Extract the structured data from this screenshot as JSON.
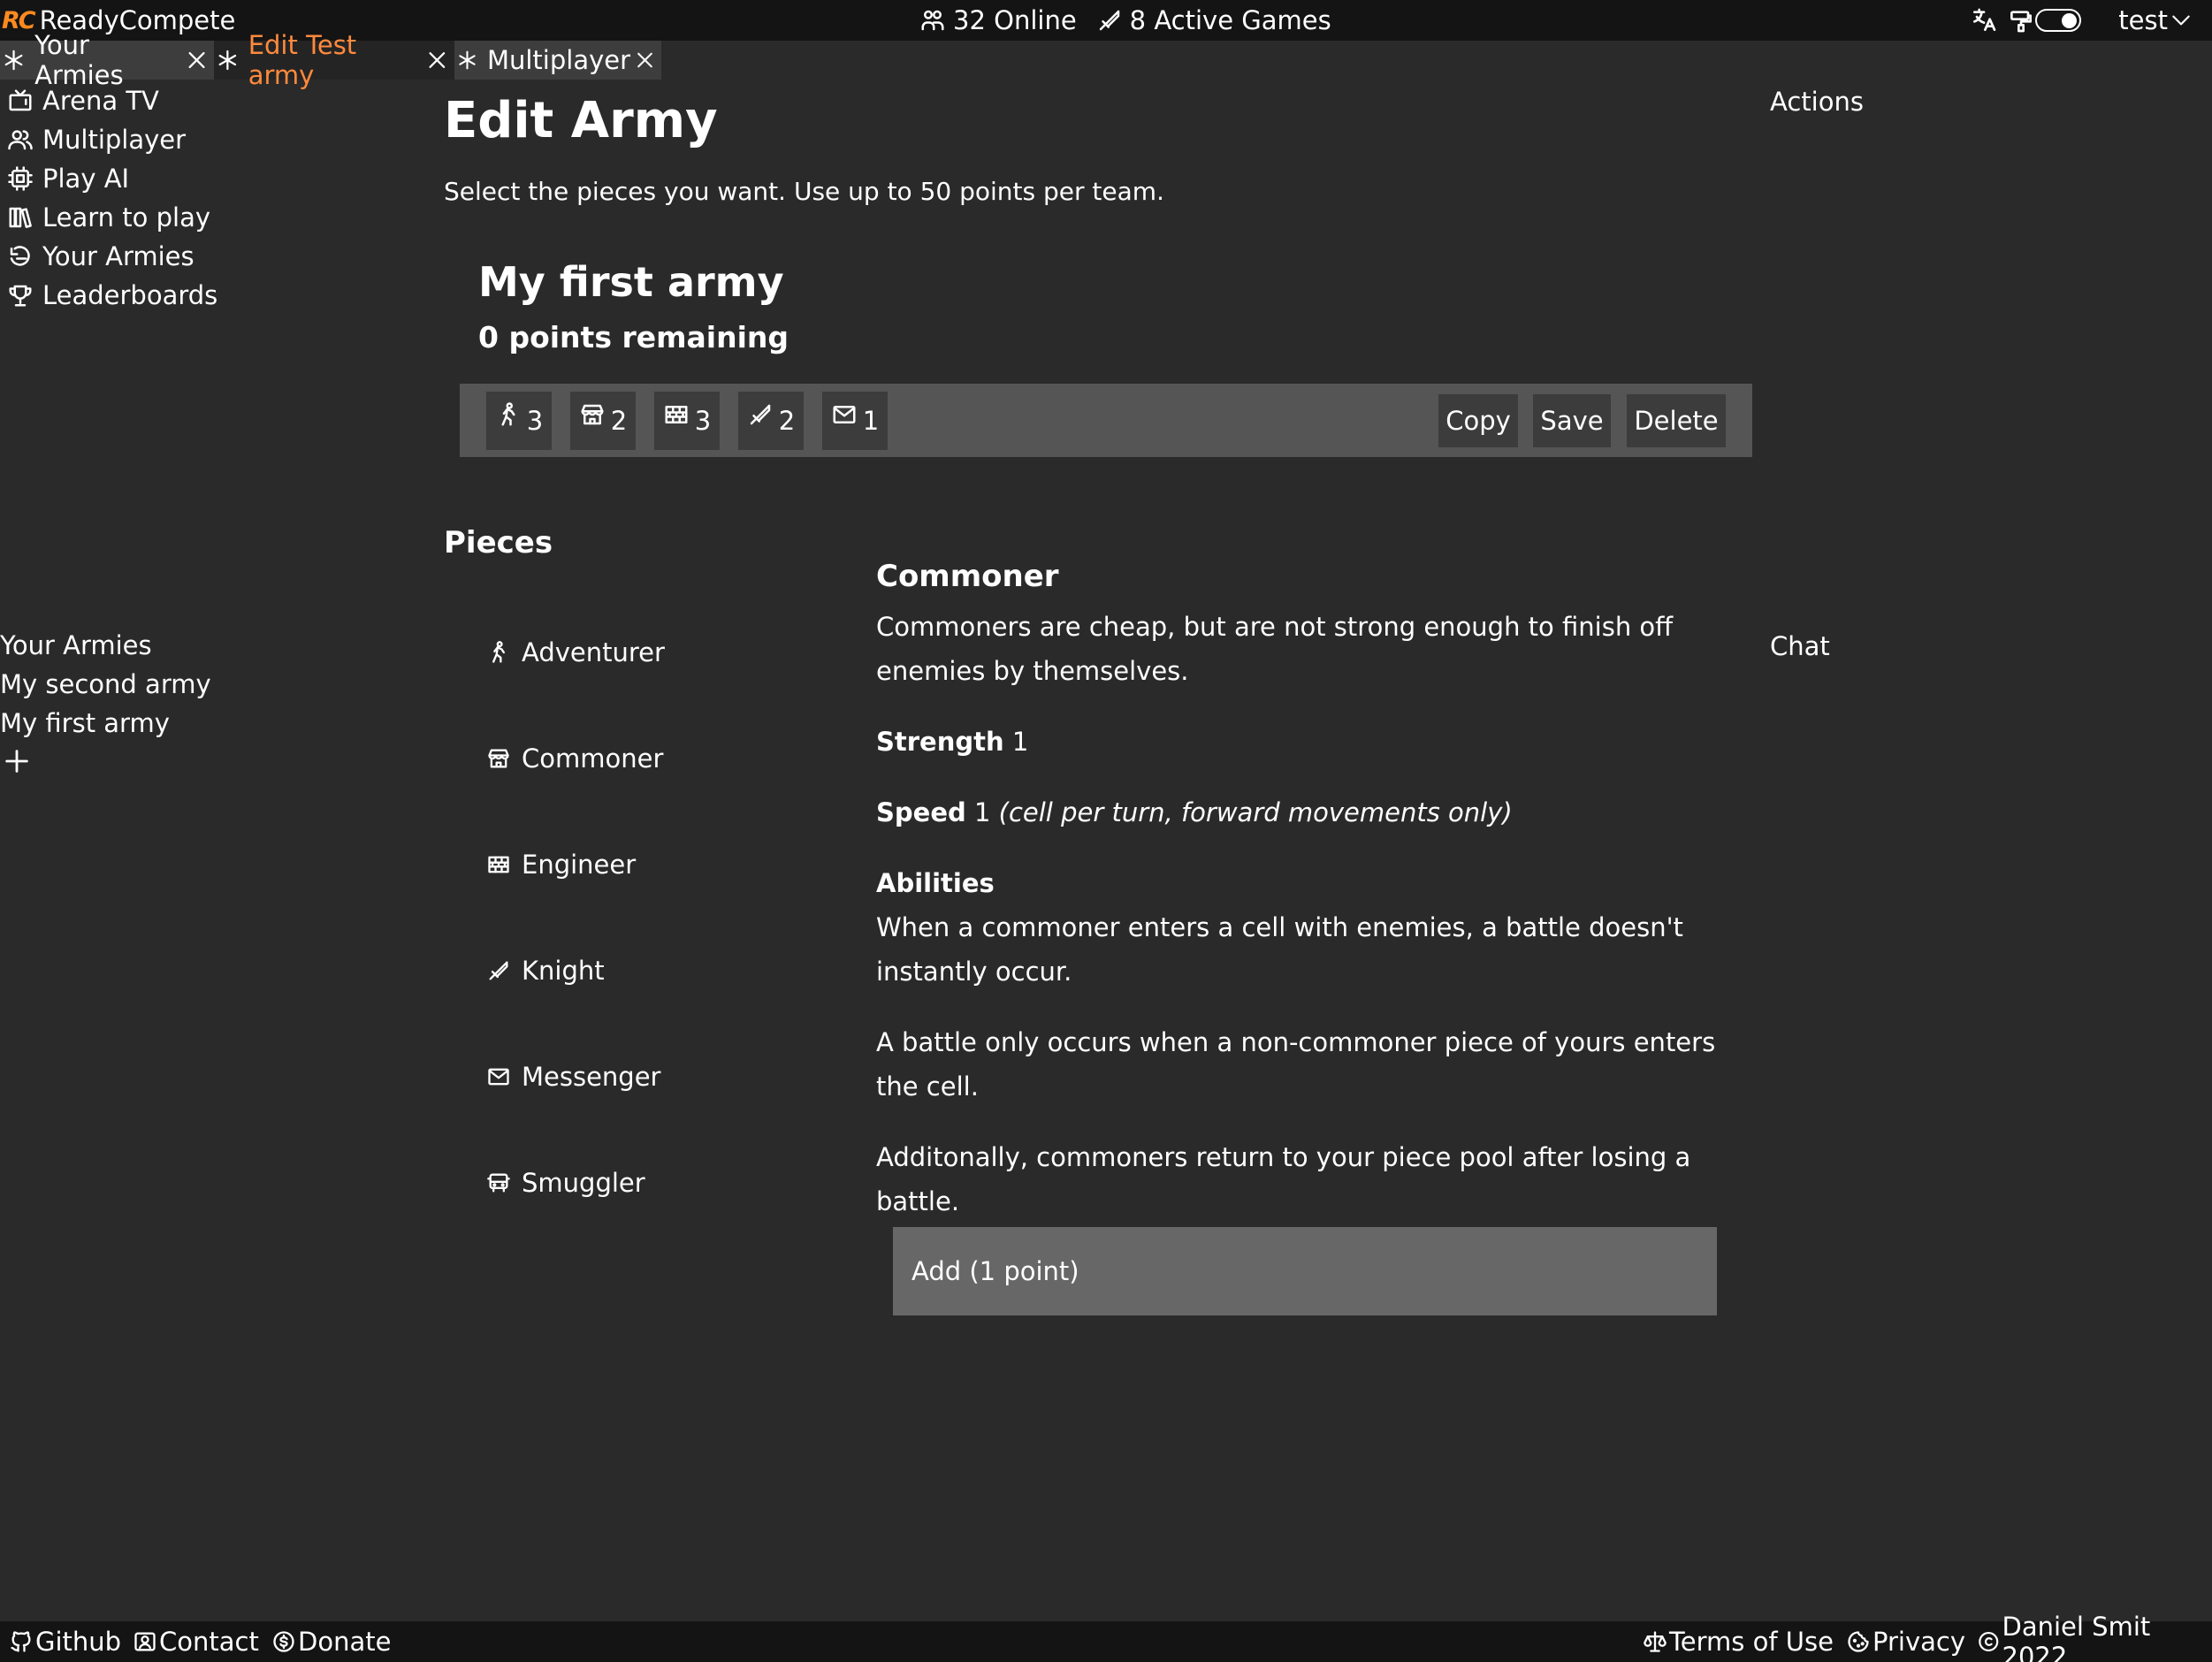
{
  "app": {
    "logo_text": "RC",
    "name": "ReadyCompete",
    "accent_color": "#ff8a3d"
  },
  "status": {
    "online": "32 Online",
    "active_games": "8 Active Games"
  },
  "user": {
    "name": "test"
  },
  "tabs": [
    {
      "label": "Your Armies",
      "active": false
    },
    {
      "label": "Edit Test army",
      "active": true
    },
    {
      "label": "Multiplayer",
      "active": false
    }
  ],
  "nav": [
    {
      "label": "Arena TV",
      "icon": "tv-icon"
    },
    {
      "label": "Multiplayer",
      "icon": "users-icon"
    },
    {
      "label": "Play AI",
      "icon": "cpu-icon"
    },
    {
      "label": "Learn to play",
      "icon": "books-icon"
    },
    {
      "label": "Your Armies",
      "icon": "army-icon"
    },
    {
      "label": "Leaderboards",
      "icon": "trophy-icon"
    }
  ],
  "armies": {
    "title": "Your Armies",
    "items": [
      "My second army",
      "My first army"
    ]
  },
  "main": {
    "title": "Edit Army",
    "subtitle": "Select the pieces you want. Use up to 50 points per team.",
    "army_name": "My first army",
    "points_remaining": "0 points remaining"
  },
  "toolbar": {
    "counts": [
      {
        "piece": "Adventurer",
        "icon": "adventurer-icon",
        "count": "3"
      },
      {
        "piece": "Commoner",
        "icon": "commoner-icon",
        "count": "2"
      },
      {
        "piece": "Engineer",
        "icon": "engineer-icon",
        "count": "3"
      },
      {
        "piece": "Knight",
        "icon": "knight-icon",
        "count": "2"
      },
      {
        "piece": "Messenger",
        "icon": "messenger-icon",
        "count": "1"
      }
    ],
    "copy_label": "Copy",
    "save_label": "Save",
    "delete_label": "Delete"
  },
  "side": {
    "actions_label": "Actions",
    "chat_label": "Chat"
  },
  "pieces": {
    "title": "Pieces",
    "items": [
      {
        "label": "Adventurer",
        "icon": "adventurer-icon"
      },
      {
        "label": "Commoner",
        "icon": "commoner-icon"
      },
      {
        "label": "Engineer",
        "icon": "engineer-icon"
      },
      {
        "label": "Knight",
        "icon": "knight-icon"
      },
      {
        "label": "Messenger",
        "icon": "messenger-icon"
      },
      {
        "label": "Smuggler",
        "icon": "smuggler-icon"
      }
    ]
  },
  "detail": {
    "title": "Commoner",
    "description": "Commoners are cheap, but are not strong enough to finish off enemies by themselves.",
    "strength_label": "Strength",
    "strength_value": "1",
    "speed_label": "Speed",
    "speed_value": "1",
    "speed_note": "(cell per turn, forward movements only)",
    "abilities_label": "Abilities",
    "abilities": [
      "When a commoner enters a cell with enemies, a battle doesn't instantly occur.",
      "A battle only occurs when a non-commoner piece of yours enters the cell.",
      "Additonally, commoners return to your piece pool after losing a battle."
    ],
    "add_label": "Add (1 point)"
  },
  "footer": {
    "github": "Github",
    "contact": "Contact",
    "donate": "Donate",
    "terms": "Terms of Use",
    "privacy": "Privacy",
    "copyright": "Daniel Smit 2022"
  }
}
